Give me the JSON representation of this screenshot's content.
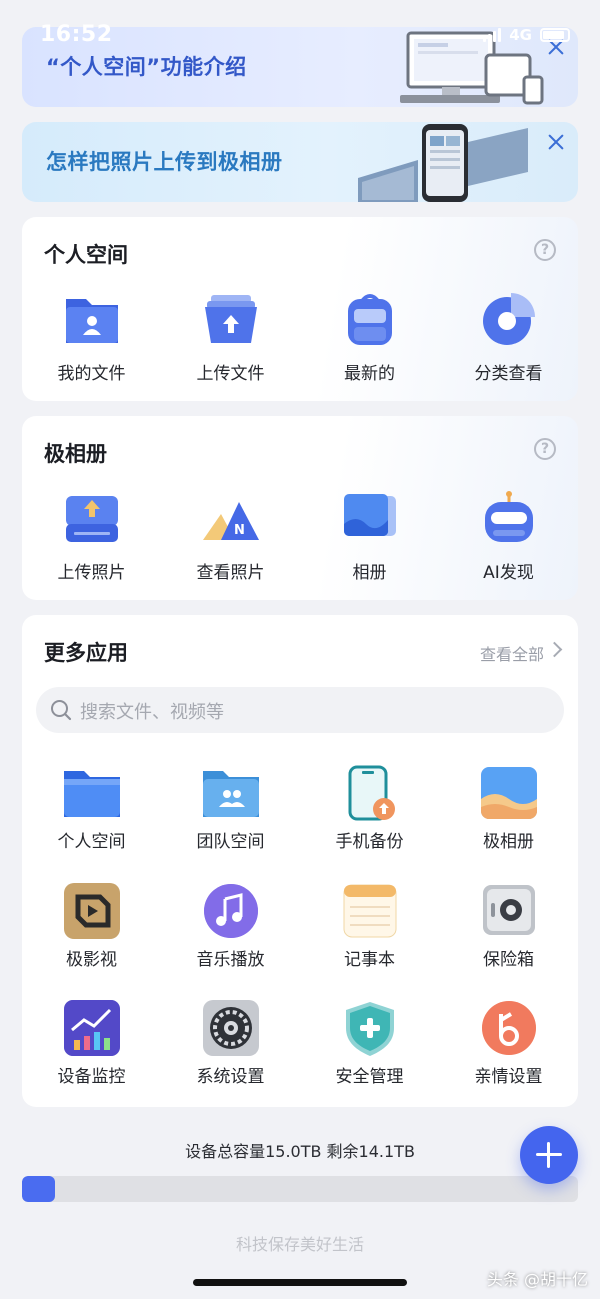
{
  "status": {
    "time": "16:52",
    "network": "4G"
  },
  "banners": [
    {
      "text": "“个人空间”功能介绍",
      "close_icon": "close-icon"
    },
    {
      "text": "怎样把照片上传到极相册",
      "close_icon": "close-icon"
    }
  ],
  "personal_space": {
    "title": "个人空间",
    "help_icon": "question-icon",
    "items": [
      {
        "label": "我的文件",
        "icon": "folder-user-icon"
      },
      {
        "label": "上传文件",
        "icon": "upload-box-icon"
      },
      {
        "label": "最新的",
        "icon": "backpack-icon"
      },
      {
        "label": "分类查看",
        "icon": "pie-chart-icon"
      }
    ]
  },
  "album": {
    "title": "极相册",
    "help_icon": "question-icon",
    "items": [
      {
        "label": "上传照片",
        "icon": "upload-drive-icon"
      },
      {
        "label": "查看照片",
        "icon": "mountains-icon"
      },
      {
        "label": "相册",
        "icon": "photo-stack-icon"
      },
      {
        "label": "AI发现",
        "icon": "robot-icon"
      }
    ]
  },
  "more_apps": {
    "title": "更多应用",
    "see_all": "查看全部",
    "search_placeholder": "搜索文件、视频等",
    "rows": [
      [
        {
          "label": "个人空间",
          "icon": "folder-icon"
        },
        {
          "label": "团队空间",
          "icon": "team-folder-icon"
        },
        {
          "label": "手机备份",
          "icon": "phone-backup-icon"
        },
        {
          "label": "极相册",
          "icon": "photo-icon"
        }
      ],
      [
        {
          "label": "极影视",
          "icon": "video-cube-icon"
        },
        {
          "label": "音乐播放",
          "icon": "music-icon"
        },
        {
          "label": "记事本",
          "icon": "notepad-icon"
        },
        {
          "label": "保险箱",
          "icon": "safe-icon"
        }
      ],
      [
        {
          "label": "设备监控",
          "icon": "monitor-chart-icon"
        },
        {
          "label": "系统设置",
          "icon": "settings-gear-icon"
        },
        {
          "label": "安全管理",
          "icon": "shield-icon"
        },
        {
          "label": "亲情设置",
          "icon": "family-icon"
        }
      ]
    ]
  },
  "storage": {
    "text": "设备总容量15.0TB 剩余14.1TB",
    "used_fraction": 0.06
  },
  "slogan": "科技保存美好生活",
  "watermark": "头条 @胡十亿"
}
